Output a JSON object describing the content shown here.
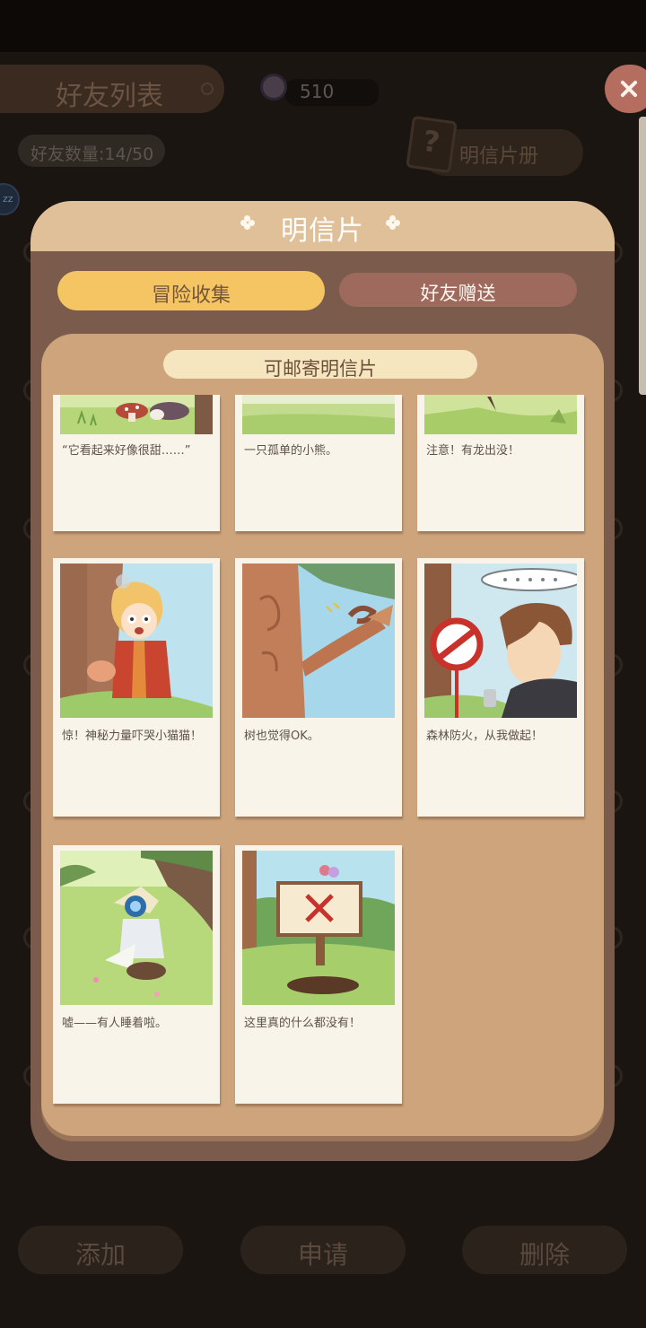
{
  "background": {
    "title": "好友列表",
    "currency_value": "510",
    "friend_count": "好友数量:14/50",
    "album_button": "明信片册",
    "avatar_badge": "zz",
    "bottom_buttons": [
      "添加",
      "申请",
      "删除"
    ]
  },
  "panel": {
    "title": "明信片",
    "tabs": [
      {
        "label": "冒险收集",
        "active": true
      },
      {
        "label": "好友赠送",
        "active": false
      }
    ],
    "section_title": "可邮寄明信片",
    "postcards": [
      {
        "caption": "“它看起来好像很甜……”",
        "scene": "mushroom-meadow"
      },
      {
        "caption": "一只孤单的小熊。",
        "scene": "green-field"
      },
      {
        "caption": "注意！有龙出没！",
        "scene": "grass-hill"
      },
      {
        "caption": "惊！神秘力量吓哭小猫猫！",
        "scene": "scared-girl"
      },
      {
        "caption": "树也觉得OK。",
        "scene": "tree-ok"
      },
      {
        "caption": "森林防火，从我做起！",
        "scene": "no-fire-sign"
      },
      {
        "caption": "嘘——有人睡着啦。",
        "scene": "sleeping-knight"
      },
      {
        "caption": "这里真的什么都没有！",
        "scene": "empty-hole-sign"
      }
    ]
  },
  "colors": {
    "panel": "#7b5c4c",
    "panel_header": "#e0c098",
    "active_tab": "#f6c563",
    "inactive_tab": "#9e6a5d",
    "inner_panel": "#cda47c",
    "close_button": "#b46d5e"
  },
  "icons": {
    "close": "close-icon",
    "currency": "heart-coin-icon",
    "album": "question-card-icon",
    "title_decoration": "flower-icon"
  }
}
